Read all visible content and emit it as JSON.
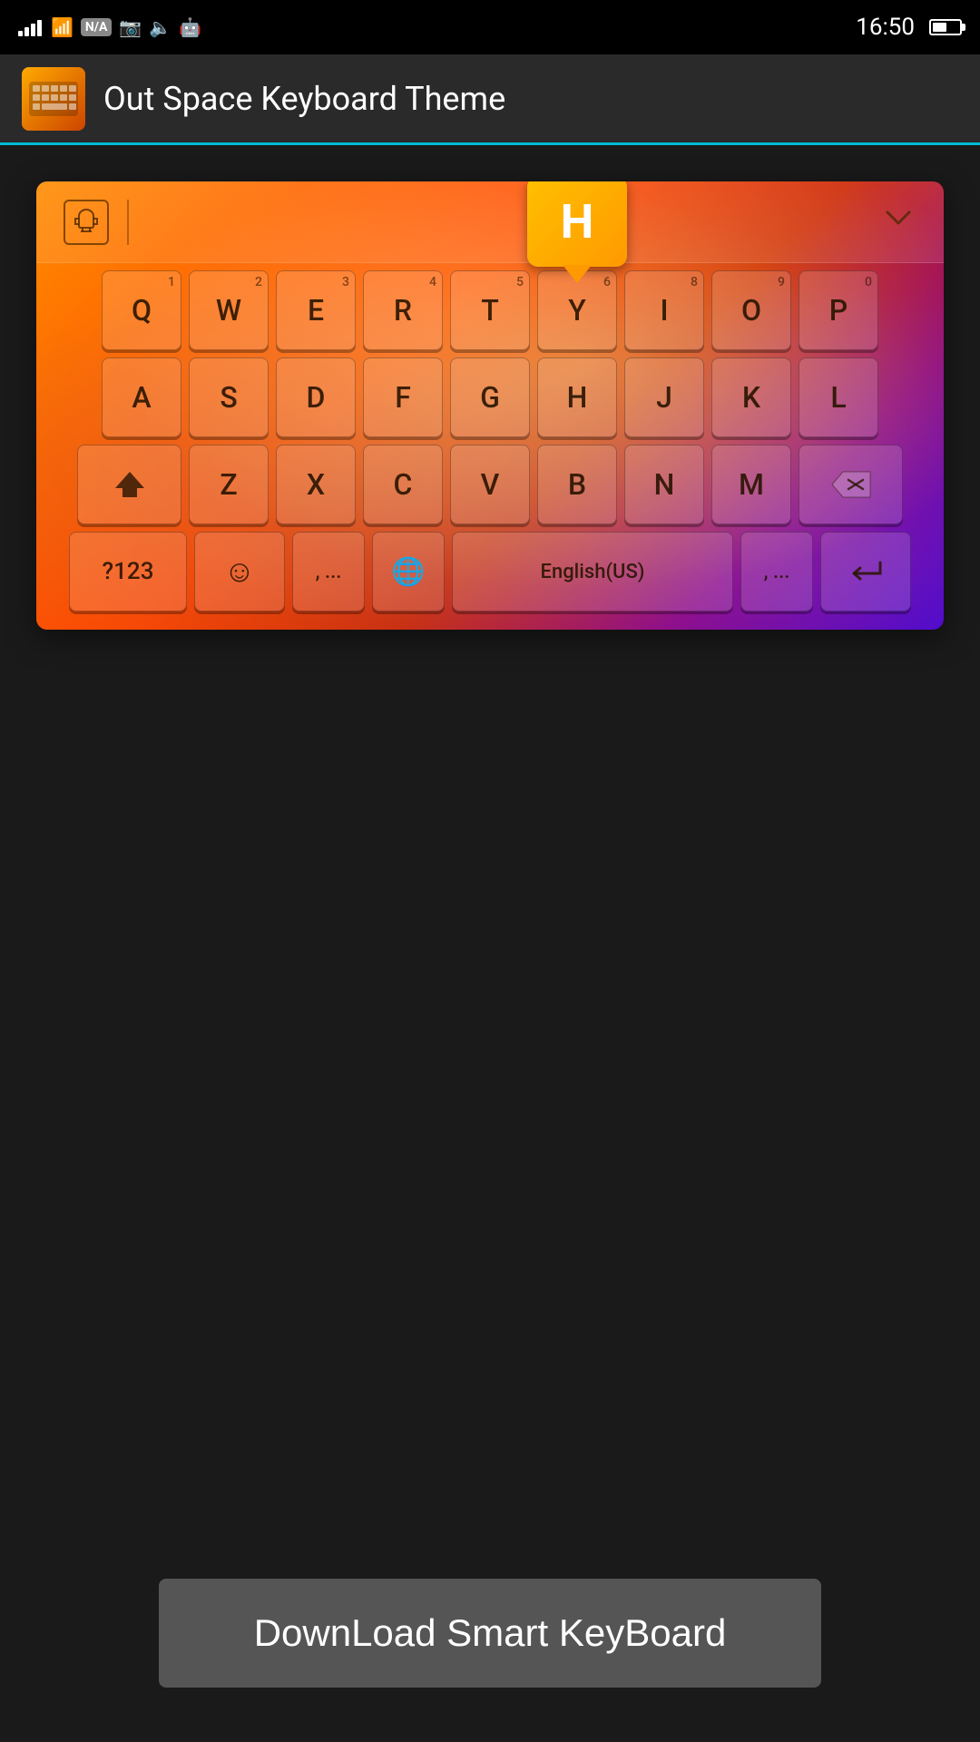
{
  "statusBar": {
    "time": "16:50",
    "wifi": "wifi-icon",
    "na": "N/A",
    "battery": "battery-icon"
  },
  "header": {
    "title": "Out Space Keyboard Theme"
  },
  "keyboard": {
    "toolbar": {
      "themeIcon": "👕",
      "chevron": "∨"
    },
    "rows": [
      {
        "keys": [
          {
            "label": "Q",
            "num": "1"
          },
          {
            "label": "W",
            "num": "2"
          },
          {
            "label": "E",
            "num": "3"
          },
          {
            "label": "R",
            "num": "4"
          },
          {
            "label": "T",
            "num": "5"
          },
          {
            "label": "Y",
            "num": "6"
          },
          {
            "label": "I",
            "num": "8"
          },
          {
            "label": "O",
            "num": "9"
          },
          {
            "label": "P",
            "num": "0"
          }
        ]
      },
      {
        "keys": [
          {
            "label": "A"
          },
          {
            "label": "S"
          },
          {
            "label": "D"
          },
          {
            "label": "F"
          },
          {
            "label": "G"
          },
          {
            "label": "H"
          },
          {
            "label": "J"
          },
          {
            "label": "K"
          },
          {
            "label": "L"
          }
        ]
      },
      {
        "keys": [
          {
            "label": "Z"
          },
          {
            "label": "X"
          },
          {
            "label": "C"
          },
          {
            "label": "V"
          },
          {
            "label": "B"
          },
          {
            "label": "N"
          },
          {
            "label": "M"
          }
        ]
      }
    ],
    "bottomRow": {
      "numbers": "?123",
      "emoji": "☺",
      "comma": ", ...",
      "globe": "🌐",
      "space": "English(US)",
      "comma2": ", ...",
      "enter": "↩"
    },
    "popup": {
      "letter": "H"
    }
  },
  "downloadButton": {
    "label": "DownLoad Smart KeyBoard"
  }
}
